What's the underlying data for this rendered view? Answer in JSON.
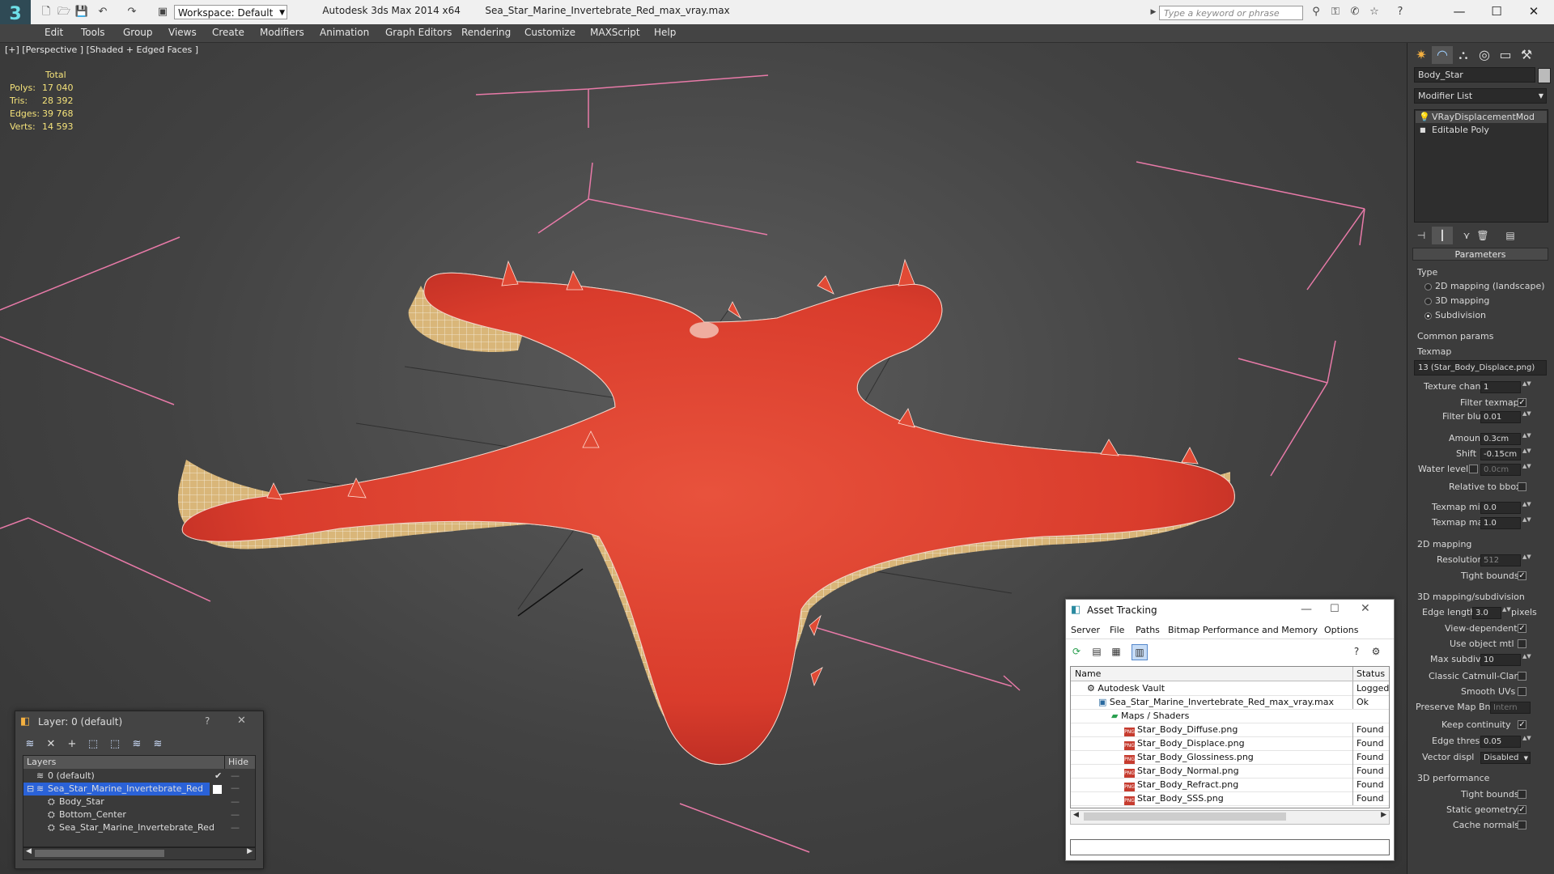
{
  "app": {
    "title": "Autodesk 3ds Max 2014 x64",
    "file": "Sea_Star_Marine_Invertebrate_Red_max_vray.max",
    "workspace": "Workspace: Default",
    "search_placeholder": "Type a keyword or phrase"
  },
  "menu": [
    "Edit",
    "Tools",
    "Group",
    "Views",
    "Create",
    "Modifiers",
    "Animation",
    "Graph Editors",
    "Rendering",
    "Customize",
    "MAXScript",
    "Help"
  ],
  "viewport": {
    "label": "[+] [Perspective ] [Shaded + Edged Faces ]",
    "stats": {
      "header": "Total",
      "rows": [
        {
          "label": "Polys:",
          "value": "17 040"
        },
        {
          "label": "Tris:",
          "value": "28 392"
        },
        {
          "label": "Edges:",
          "value": "39 768"
        },
        {
          "label": "Verts:",
          "value": "14 593"
        }
      ]
    }
  },
  "command_panel": {
    "object_name": "Body_Star",
    "modifier_list": "Modifier List",
    "stack": [
      "VRayDisplacementMod",
      "Editable Poly"
    ],
    "parameters_title": "Parameters",
    "type_label": "Type",
    "type_options": [
      {
        "label": "2D mapping (landscape)",
        "selected": false
      },
      {
        "label": "3D mapping",
        "selected": false
      },
      {
        "label": "Subdivision",
        "selected": true
      }
    ],
    "common_params": "Common params",
    "texmap_label": "Texmap",
    "texmap_value": "13 (Star_Body_Displace.png)",
    "texture_chan_label": "Texture chan",
    "texture_chan_value": "1",
    "filter_texmap_label": "Filter texmap",
    "filter_blur_label": "Filter blur",
    "filter_blur_value": "0.01",
    "amount_label": "Amount",
    "amount_value": "0.3cm",
    "shift_label": "Shift",
    "shift_value": "-0.15cm",
    "water_level_label": "Water level",
    "water_level_value": "0.0cm",
    "relative_bbox_label": "Relative to bbox",
    "texmap_min_label": "Texmap min",
    "texmap_min_value": "0.0",
    "texmap_max_label": "Texmap max",
    "texmap_max_value": "1.0",
    "mapping_2d_label": "2D mapping",
    "resolution_label": "Resolution",
    "resolution_value": "512",
    "tight_bounds_label": "Tight bounds",
    "mapping_3d_label": "3D mapping/subdivision",
    "edge_length_label": "Edge length",
    "edge_length_value": "3.0",
    "pixels_label": "pixels",
    "view_dependent_label": "View-dependent",
    "use_object_mtl_label": "Use object mtl",
    "max_subdivs_label": "Max subdivs",
    "max_subdivs_value": "10",
    "catmull_label": "Classic Catmull-Clark",
    "smooth_uvs_label": "Smooth UVs",
    "preserve_map_label": "Preserve Map Bnd",
    "preserve_map_value": "Intern",
    "keep_continuity_label": "Keep continuity",
    "edge_thresh_label": "Edge thresh",
    "edge_thresh_value": "0.05",
    "vector_displ_label": "Vector displ",
    "vector_displ_value": "Disabled",
    "perf_label": "3D performance",
    "perf_tight_bounds_label": "Tight bounds",
    "static_geometry_label": "Static geometry",
    "cache_normals_label": "Cache normals"
  },
  "asset_tracking": {
    "title": "Asset Tracking",
    "menus": [
      "Server",
      "File",
      "Paths",
      "Bitmap Performance and Memory",
      "Options"
    ],
    "col_name": "Name",
    "col_status": "Status",
    "rows": [
      {
        "name": "Autodesk Vault",
        "status": "Logged O"
      },
      {
        "name": "Sea_Star_Marine_Invertebrate_Red_max_vray.max",
        "status": "Ok"
      },
      {
        "name": "Maps / Shaders",
        "status": ""
      },
      {
        "name": "Star_Body_Diffuse.png",
        "status": "Found"
      },
      {
        "name": "Star_Body_Displace.png",
        "status": "Found"
      },
      {
        "name": "Star_Body_Glossiness.png",
        "status": "Found"
      },
      {
        "name": "Star_Body_Normal.png",
        "status": "Found"
      },
      {
        "name": "Star_Body_Refract.png",
        "status": "Found"
      },
      {
        "name": "Star_Body_SSS.png",
        "status": "Found"
      }
    ],
    "png_tag": "PNG"
  },
  "layer_manager": {
    "title": "Layer: 0 (default)",
    "help": "?",
    "col_layers": "Layers",
    "col_hide": "Hide",
    "rows": [
      {
        "name": "0 (default)"
      },
      {
        "name": "Sea_Star_Marine_Invertebrate_Red"
      },
      {
        "name": "Body_Star"
      },
      {
        "name": "Bottom_Center"
      },
      {
        "name": "Sea_Star_Marine_Invertebrate_Red"
      }
    ]
  },
  "colors": {
    "viewport_bg": "#444444",
    "star_red": "#d8402e",
    "stats_yellow": "#f4e27a",
    "bbox_pink": "#e87aa8",
    "selection_blue": "#2a62d8"
  }
}
